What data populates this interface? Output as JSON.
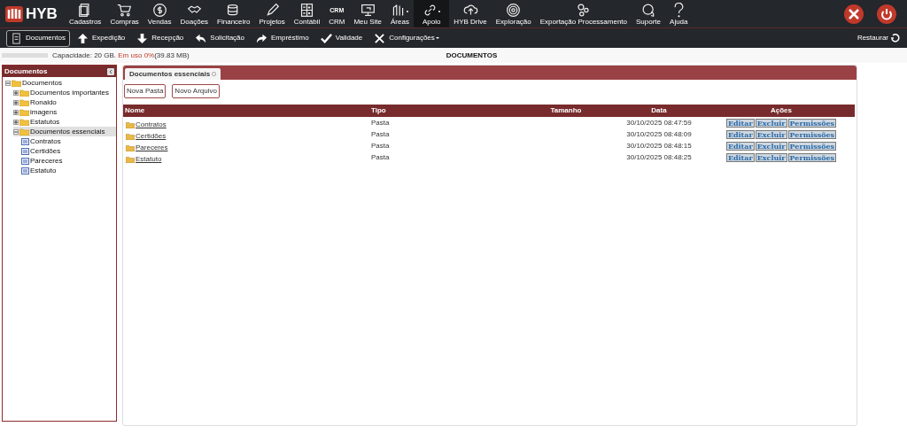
{
  "brand": "HYB",
  "nav": [
    {
      "label": "Cadastros",
      "selected": false
    },
    {
      "label": "Compras",
      "selected": false
    },
    {
      "label": "Vendas",
      "selected": false
    },
    {
      "label": "Doações",
      "selected": false
    },
    {
      "label": "Financeiro",
      "selected": false
    },
    {
      "label": "Projetos",
      "selected": false
    },
    {
      "label": "Contábil",
      "selected": false
    },
    {
      "label": "CRM",
      "icon_text": "CRM",
      "selected": false
    },
    {
      "label": "Meu Site",
      "selected": false
    },
    {
      "label": "Áreas",
      "dropdown": true,
      "selected": false
    },
    {
      "label": "Apoio",
      "dropdown": true,
      "selected": true
    },
    {
      "label": "HYB Drive",
      "selected": false
    },
    {
      "label": "Exploração",
      "selected": false
    },
    {
      "label": "Exportação Processamento",
      "selected": false
    },
    {
      "label": "Suporte",
      "selected": false
    },
    {
      "label": "Ajuda",
      "selected": false
    }
  ],
  "subnav": [
    {
      "label": "Documentos",
      "selected": true
    },
    {
      "label": "Expedição",
      "selected": false
    },
    {
      "label": "Recepção",
      "selected": false
    },
    {
      "label": "Solicitação",
      "selected": false
    },
    {
      "label": "Empréstimo",
      "selected": false
    },
    {
      "label": "Validade",
      "selected": false
    },
    {
      "label": "Configurações",
      "dropdown": true,
      "selected": false
    }
  ],
  "restore": "Restaurar",
  "capacity": {
    "label": "Capacidade: 20 GB.",
    "usage": "Em uso 0%",
    "size": "(39.83 MB)"
  },
  "page_title": "DOCUMENTOS",
  "sidebar": {
    "title": "Documentos",
    "tree": [
      {
        "label": "Documentos",
        "kind": "folder",
        "expanded": true,
        "selected": false,
        "children": [
          {
            "label": "Documentos importantes",
            "kind": "folder",
            "expanded": false,
            "selected": false
          },
          {
            "label": "Ronaldo",
            "kind": "folder",
            "expanded": false,
            "selected": false
          },
          {
            "label": "imagens",
            "kind": "folder",
            "expanded": false,
            "selected": false
          },
          {
            "label": "Estatutos",
            "kind": "folder",
            "expanded": false,
            "selected": false
          },
          {
            "label": "Documentos essenciais",
            "kind": "folder",
            "expanded": true,
            "selected": true,
            "children": [
              {
                "label": "Contratos",
                "kind": "list",
                "selected": false
              },
              {
                "label": "Certidões",
                "kind": "list",
                "selected": false
              },
              {
                "label": "Pareceres",
                "kind": "list",
                "selected": false
              },
              {
                "label": "Estatuto",
                "kind": "list",
                "selected": false
              }
            ]
          }
        ]
      }
    ]
  },
  "tab": {
    "label": "Documentos essenciais",
    "selected": true
  },
  "buttons": [
    "Nova Pasta",
    "Novo Arquivo"
  ],
  "table": {
    "columns": [
      "Nome",
      "Tipo",
      "Tamanho",
      "Data",
      "Ações"
    ],
    "rows": [
      {
        "name": "Contratos",
        "type": "Pasta",
        "date": "30/10/2025 08:47:59",
        "actions": [
          "Editar",
          "Excluir",
          "Permissões"
        ]
      },
      {
        "name": "Certidões",
        "type": "Pasta",
        "date": "30/10/2025 08:48:09",
        "actions": [
          "Editar",
          "Excluir",
          "Permissões"
        ]
      },
      {
        "name": "Pareceres",
        "type": "Pasta",
        "date": "30/10/2025 08:48:15",
        "actions": [
          "Editar",
          "Excluir",
          "Permissões"
        ]
      },
      {
        "name": "Estatuto",
        "type": "Pasta",
        "date": "30/10/2025 08:48:25",
        "actions": [
          "Editar",
          "Excluir",
          "Permissões"
        ]
      }
    ]
  }
}
